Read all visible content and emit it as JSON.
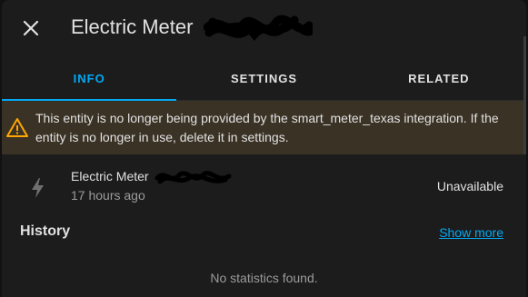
{
  "dialog": {
    "title": "Electric Meter",
    "close_icon": "close-icon"
  },
  "tabs": [
    {
      "label": "INFO",
      "active": true
    },
    {
      "label": "SETTINGS",
      "active": false
    },
    {
      "label": "RELATED",
      "active": false
    }
  ],
  "warning": {
    "icon": "alert-triangle-icon",
    "text": "This entity is no longer being provided by the smart_meter_texas integration. If the entity is no longer in use, delete it in settings."
  },
  "entity": {
    "icon": "lightning-bolt-icon",
    "name": "Electric Meter",
    "last_changed": "17 hours ago",
    "state": "Unavailable"
  },
  "history": {
    "title": "History",
    "show_more": "Show more",
    "empty_text": "No statistics found."
  },
  "colors": {
    "accent": "#03a9f4",
    "warning": "#ffa600",
    "warning_bg": "#3a3225",
    "background": "#1c1c1c"
  }
}
